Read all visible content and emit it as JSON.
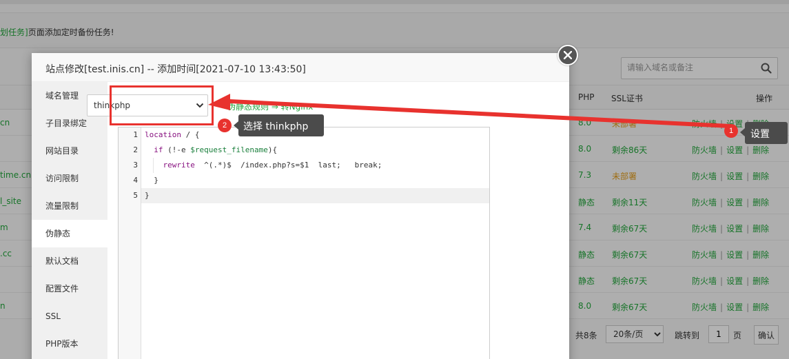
{
  "background": {
    "tip": {
      "link_text": "划任务]",
      "text": "页面添加定时备份任务!"
    },
    "search": {
      "placeholder": "请输入域名或备注",
      "icon": "search-icon"
    },
    "table": {
      "headers": {
        "php": "PHP",
        "ssl": "SSL证书",
        "ops": "操作"
      },
      "rows": [
        {
          "site": "cn",
          "php": "8.0",
          "ssl": "未部署",
          "ssl_color": "#e39c1a"
        },
        {
          "site": "",
          "php": "8.0",
          "ssl": "剩余86天",
          "ssl_color": "#20a53a"
        },
        {
          "site": "time.cn",
          "php": "7.3",
          "ssl": "未部署",
          "ssl_color": "#e39c1a"
        },
        {
          "site": "l_site",
          "php": "静态",
          "ssl": "剩余11天",
          "ssl_color": "#20a53a"
        },
        {
          "site": "m",
          "php": "7.4",
          "ssl": "剩余67天",
          "ssl_color": "#20a53a"
        },
        {
          "site": ".cc",
          "php": "静态",
          "ssl": "剩余67天",
          "ssl_color": "#20a53a"
        },
        {
          "site": "",
          "php": "静态",
          "ssl": "剩余67天",
          "ssl_color": "#20a53a"
        },
        {
          "site": "n",
          "php": "8.0",
          "ssl": "剩余67天",
          "ssl_color": "#20a53a"
        }
      ],
      "ops": {
        "firewall": "防火墙",
        "settings": "设置",
        "delete": "删除",
        "separator": "|"
      }
    },
    "pager": {
      "total": "共8条",
      "per_page": "20条/页",
      "jump_to": "跳转到",
      "page_value": "1",
      "page_unit": "页",
      "confirm": "确认"
    }
  },
  "modal": {
    "title": "站点修改[test.inis.cn] -- 添加时间[2021-07-10 13:43:50]",
    "nav": [
      "域名管理",
      "子目录绑定",
      "网站目录",
      "访问限制",
      "流量限制",
      "伪静态",
      "默认文档",
      "配置文件",
      "SSL",
      "PHP版本"
    ],
    "active_nav": "伪静态",
    "rewrite_select": {
      "value": "thinkphp",
      "options": [
        "thinkphp"
      ]
    },
    "behind_text": "伪静态规则   ⇒ 转Nginx",
    "code": {
      "line_numbers": [
        "1",
        "2",
        "3",
        "4",
        "5"
      ],
      "lines": [
        "location / {",
        "  if (!-e $request_filename){",
        "    rewrite  ^(.*)$  /index.php?s=$1  last;   break;",
        "  }",
        "}"
      ]
    }
  },
  "annotations": {
    "step1": {
      "number": "1",
      "label": "设置"
    },
    "step2": {
      "number": "2",
      "label": "选择 thinkphp"
    },
    "color": "#e8322e"
  }
}
